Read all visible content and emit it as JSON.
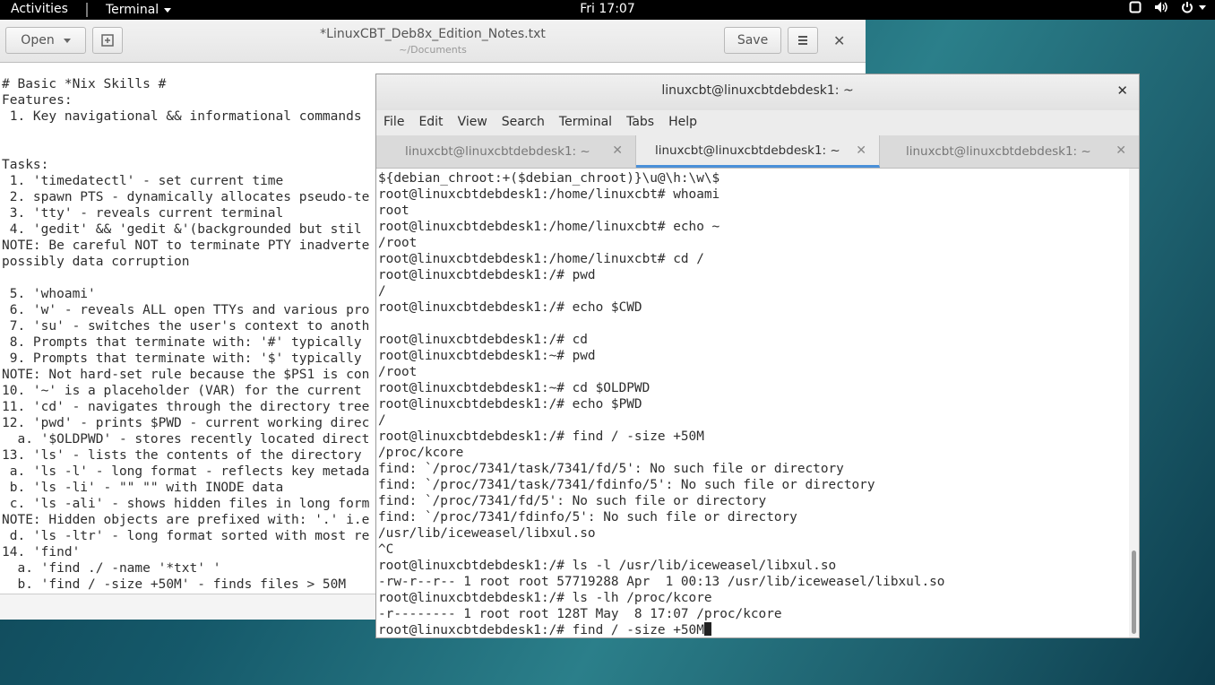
{
  "topbar": {
    "activities": "Activities",
    "app": "Terminal",
    "clock": "Fri 17:07"
  },
  "gedit": {
    "open_label": "Open",
    "title": "*LinuxCBT_Deb8x_Edition_Notes.txt",
    "subtitle": "~/Documents",
    "save_label": "Save",
    "content": "# Basic *Nix Skills #\nFeatures:\n 1. Key navigational && informational commands\n\n\nTasks:\n 1. 'timedatectl' - set current time\n 2. spawn PTS - dynamically allocates pseudo-te\n 3. 'tty' - reveals current terminal\n 4. 'gedit' && 'gedit &'(backgrounded but stil\nNOTE: Be careful NOT to terminate PTY inadverte\npossibly data corruption\n\n 5. 'whoami'\n 6. 'w' - reveals ALL open TTYs and various pro\n 7. 'su' - switches the user's context to anoth\n 8. Prompts that terminate with: '#' typically\n 9. Prompts that terminate with: '$' typically\nNOTE: Not hard-set rule because the $PS1 is con\n10. '~' is a placeholder (VAR) for the current\n11. 'cd' - navigates through the directory tree\n12. 'pwd' - prints $PWD - current working direc\n  a. '$OLDPWD' - stores recently located direct\n13. 'ls' - lists the contents of the directory\n a. 'ls -l' - long format - reflects key metada\n b. 'ls -li' - \"\" \"\" with INODE data\n c. 'ls -ali' - shows hidden files in long form\nNOTE: Hidden objects are prefixed with: '.' i.e\n d. 'ls -ltr' - long format sorted with most re\n14. 'find'\n  a. 'find ./ -name '*txt' '\n  b. 'find / -size +50M' - finds files > 50M"
  },
  "terminal": {
    "title": "linuxcbt@linuxcbtdebdesk1: ~",
    "menu": [
      "File",
      "Edit",
      "View",
      "Search",
      "Terminal",
      "Tabs",
      "Help"
    ],
    "tabs": [
      "linuxcbt@linuxcbtdebdesk1: ~",
      "linuxcbt@linuxcbtdebdesk1: ~",
      "linuxcbt@linuxcbtdebdesk1: ~"
    ],
    "output": "${debian_chroot:+($debian_chroot)}\\u@\\h:\\w\\$\nroot@linuxcbtdebdesk1:/home/linuxcbt# whoami\nroot\nroot@linuxcbtdebdesk1:/home/linuxcbt# echo ~\n/root\nroot@linuxcbtdebdesk1:/home/linuxcbt# cd /\nroot@linuxcbtdebdesk1:/# pwd\n/\nroot@linuxcbtdebdesk1:/# echo $CWD\n\nroot@linuxcbtdebdesk1:/# cd\nroot@linuxcbtdebdesk1:~# pwd\n/root\nroot@linuxcbtdebdesk1:~# cd $OLDPWD\nroot@linuxcbtdebdesk1:/# echo $PWD\n/\nroot@linuxcbtdebdesk1:/# find / -size +50M\n/proc/kcore\nfind: `/proc/7341/task/7341/fd/5': No such file or directory\nfind: `/proc/7341/task/7341/fdinfo/5': No such file or directory\nfind: `/proc/7341/fd/5': No such file or directory\nfind: `/proc/7341/fdinfo/5': No such file or directory\n/usr/lib/iceweasel/libxul.so\n^C\nroot@linuxcbtdebdesk1:/# ls -l /usr/lib/iceweasel/libxul.so\n-rw-r--r-- 1 root root 57719288 Apr  1 00:13 /usr/lib/iceweasel/libxul.so\nroot@linuxcbtdebdesk1:/# ls -lh /proc/kcore\n-r-------- 1 root root 128T May  8 17:07 /proc/kcore",
    "current_command": "root@linuxcbtdebdesk1:/# find / -size +50M"
  }
}
